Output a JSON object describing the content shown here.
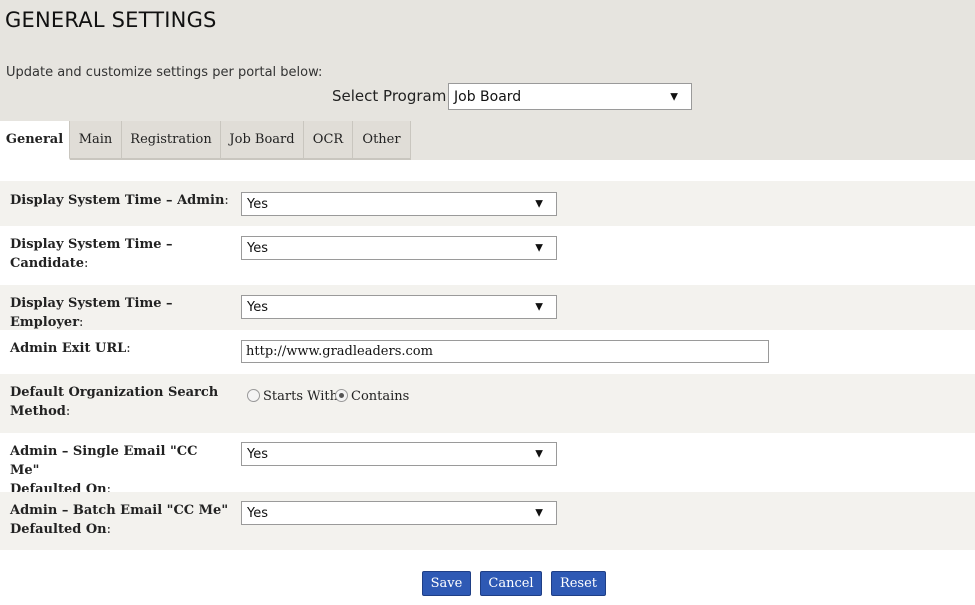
{
  "page": {
    "title": "GENERAL SETTINGS",
    "subtitle": "Update and customize settings per portal below:"
  },
  "program": {
    "label": "Select Program:",
    "value": "Job Board"
  },
  "tabs": [
    {
      "label": "General",
      "active": true
    },
    {
      "label": "Main",
      "active": false
    },
    {
      "label": "Registration",
      "active": false
    },
    {
      "label": "Job Board",
      "active": false
    },
    {
      "label": "OCR",
      "active": false
    },
    {
      "label": "Other",
      "active": false
    }
  ],
  "settings": {
    "display_time_admin": {
      "label_line1": "Display System Time – Admin",
      "value": "Yes"
    },
    "display_time_candidate": {
      "label_line1": "Display System Time –",
      "label_line2": "Candidate",
      "value": "Yes"
    },
    "display_time_employer": {
      "label_line1": "Display System Time – Employer",
      "value": "Yes"
    },
    "admin_exit_url": {
      "label_line1": "Admin Exit URL",
      "value": "http://www.gradleaders.com"
    },
    "org_search_method": {
      "label_line1": "Default Organization Search",
      "label_line2": "Method",
      "options": [
        {
          "label": "Starts With",
          "checked": false
        },
        {
          "label": "Contains",
          "checked": true
        }
      ]
    },
    "single_email_cc": {
      "label_line1": "Admin – Single Email \"CC Me\"",
      "label_line2": "Defaulted On",
      "value": "Yes"
    },
    "batch_email_cc": {
      "label_line1": "Admin – Batch Email \"CC Me\"",
      "label_line2": "Defaulted On",
      "value": "Yes"
    }
  },
  "buttons": {
    "save": "Save",
    "cancel": "Cancel",
    "reset": "Reset"
  },
  "punctuation": {
    "colon": ":"
  },
  "icons": {
    "dropdown": "caret-down-icon"
  },
  "colors": {
    "header_bg": "#e6e4df",
    "row_shade": "#f3f2ee",
    "button_bg": "#2e59b4"
  }
}
